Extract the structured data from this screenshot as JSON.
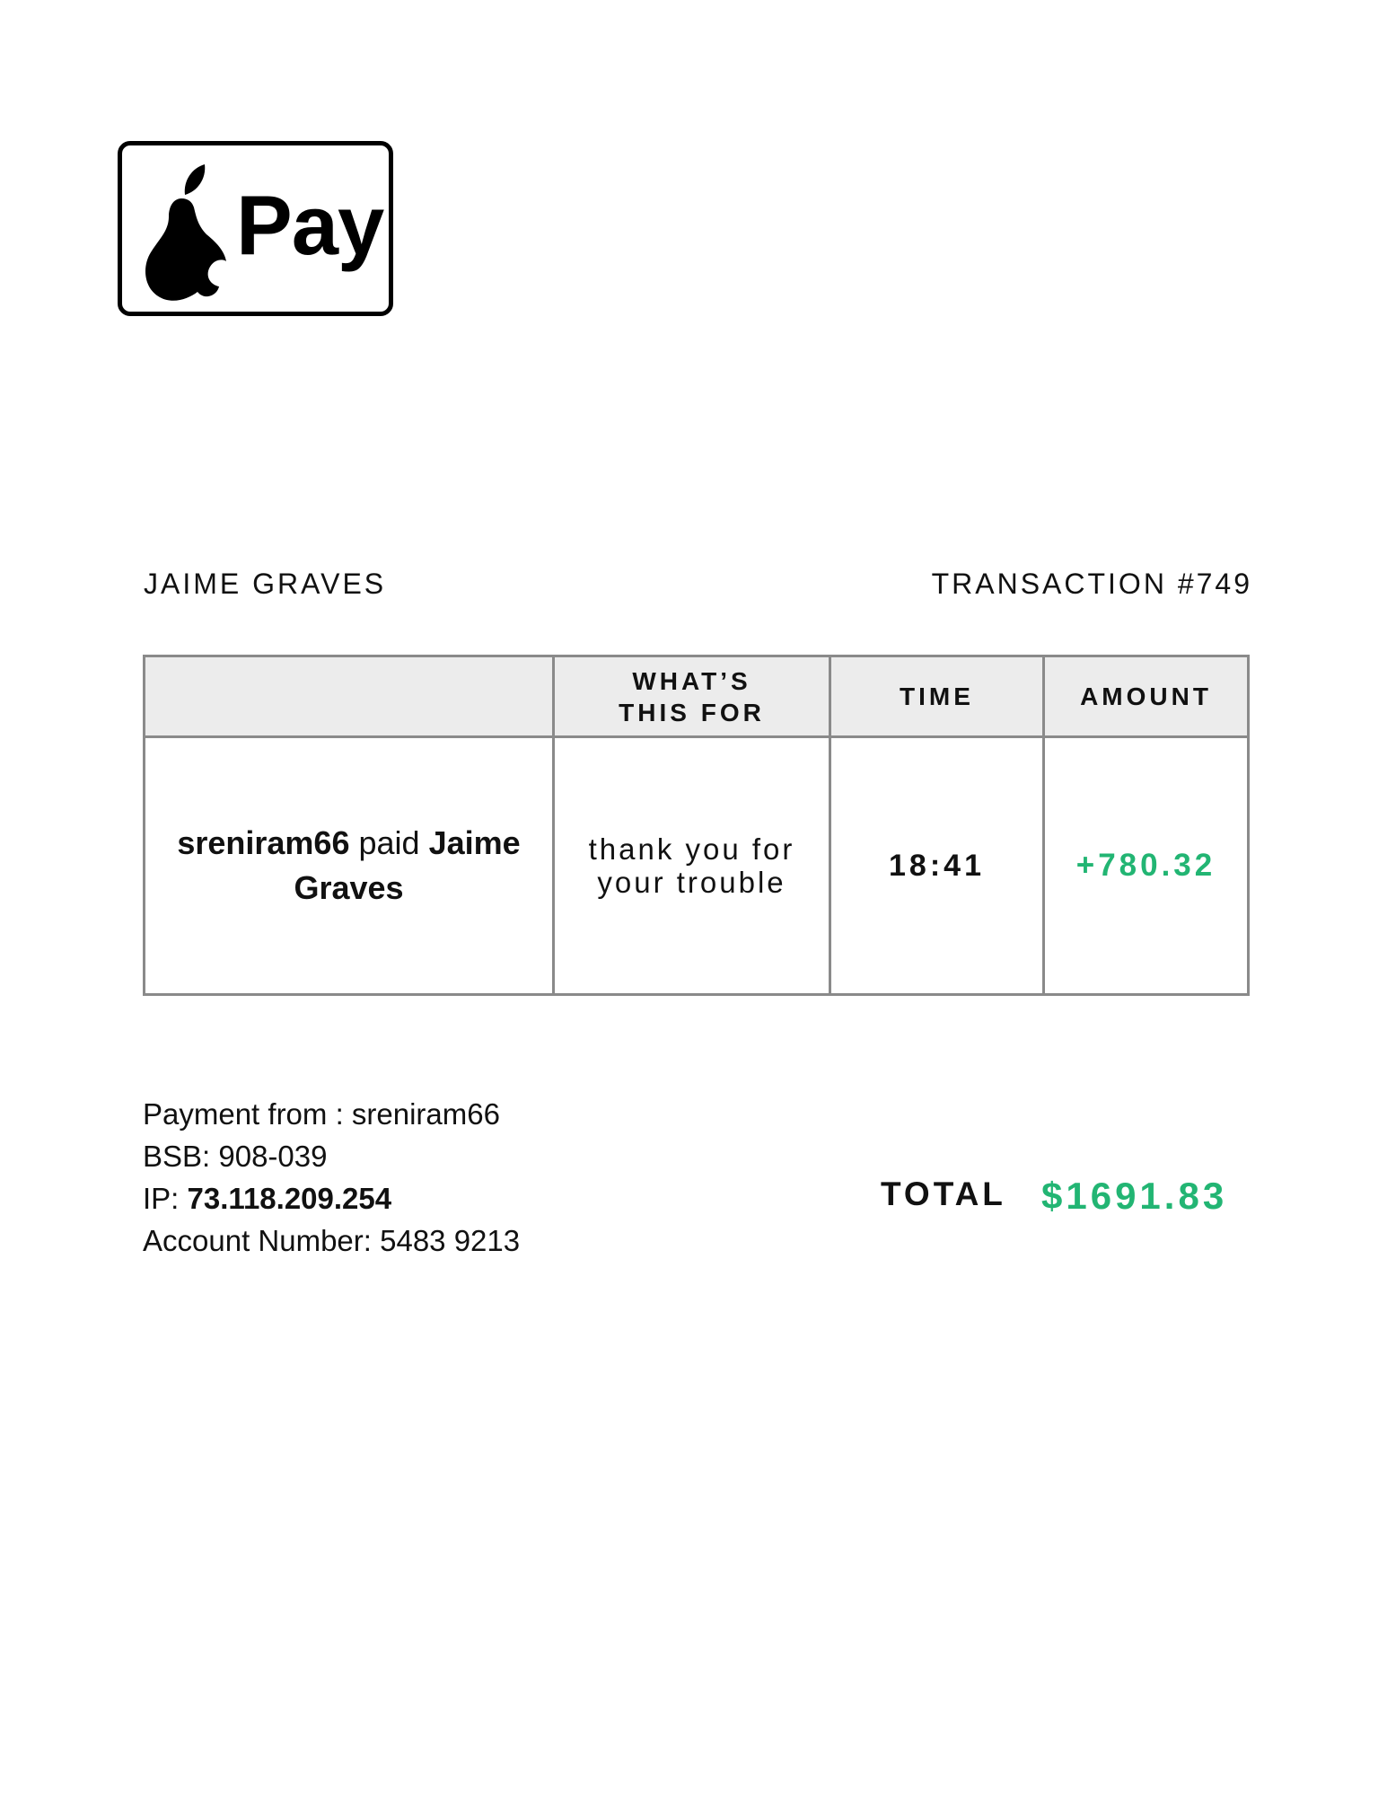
{
  "logo": {
    "text": "Pay",
    "icon": "pear-icon"
  },
  "header": {
    "name": "JAIME GRAVES",
    "transaction": "TRANSACTION #749"
  },
  "table": {
    "headers": [
      "",
      "WHAT’S THIS FOR",
      "TIME",
      "AMOUNT"
    ],
    "header_for_line1": "WHAT’S",
    "header_for_line2": "THIS FOR",
    "row": {
      "payer": "sreniram66",
      "paid_word": " paid ",
      "payee": "Jaime Graves",
      "note_line1": "thank you for",
      "note_line2": "your trouble",
      "time": "18:41",
      "amount": "+780.32"
    }
  },
  "info": {
    "payment_from_label": "Payment from : ",
    "payment_from": "sreniram66",
    "bsb_label": "BSB: ",
    "bsb": "908-039",
    "ip_label": "IP: ",
    "ip": "73.118.209.254",
    "account_label": "Account Number: ",
    "account": "5483 9213"
  },
  "total": {
    "label": "TOTAL",
    "value": "$1691.83"
  },
  "colors": {
    "amount_green": "#22b573",
    "header_bg": "#ececec",
    "border": "#8a8a8a"
  }
}
